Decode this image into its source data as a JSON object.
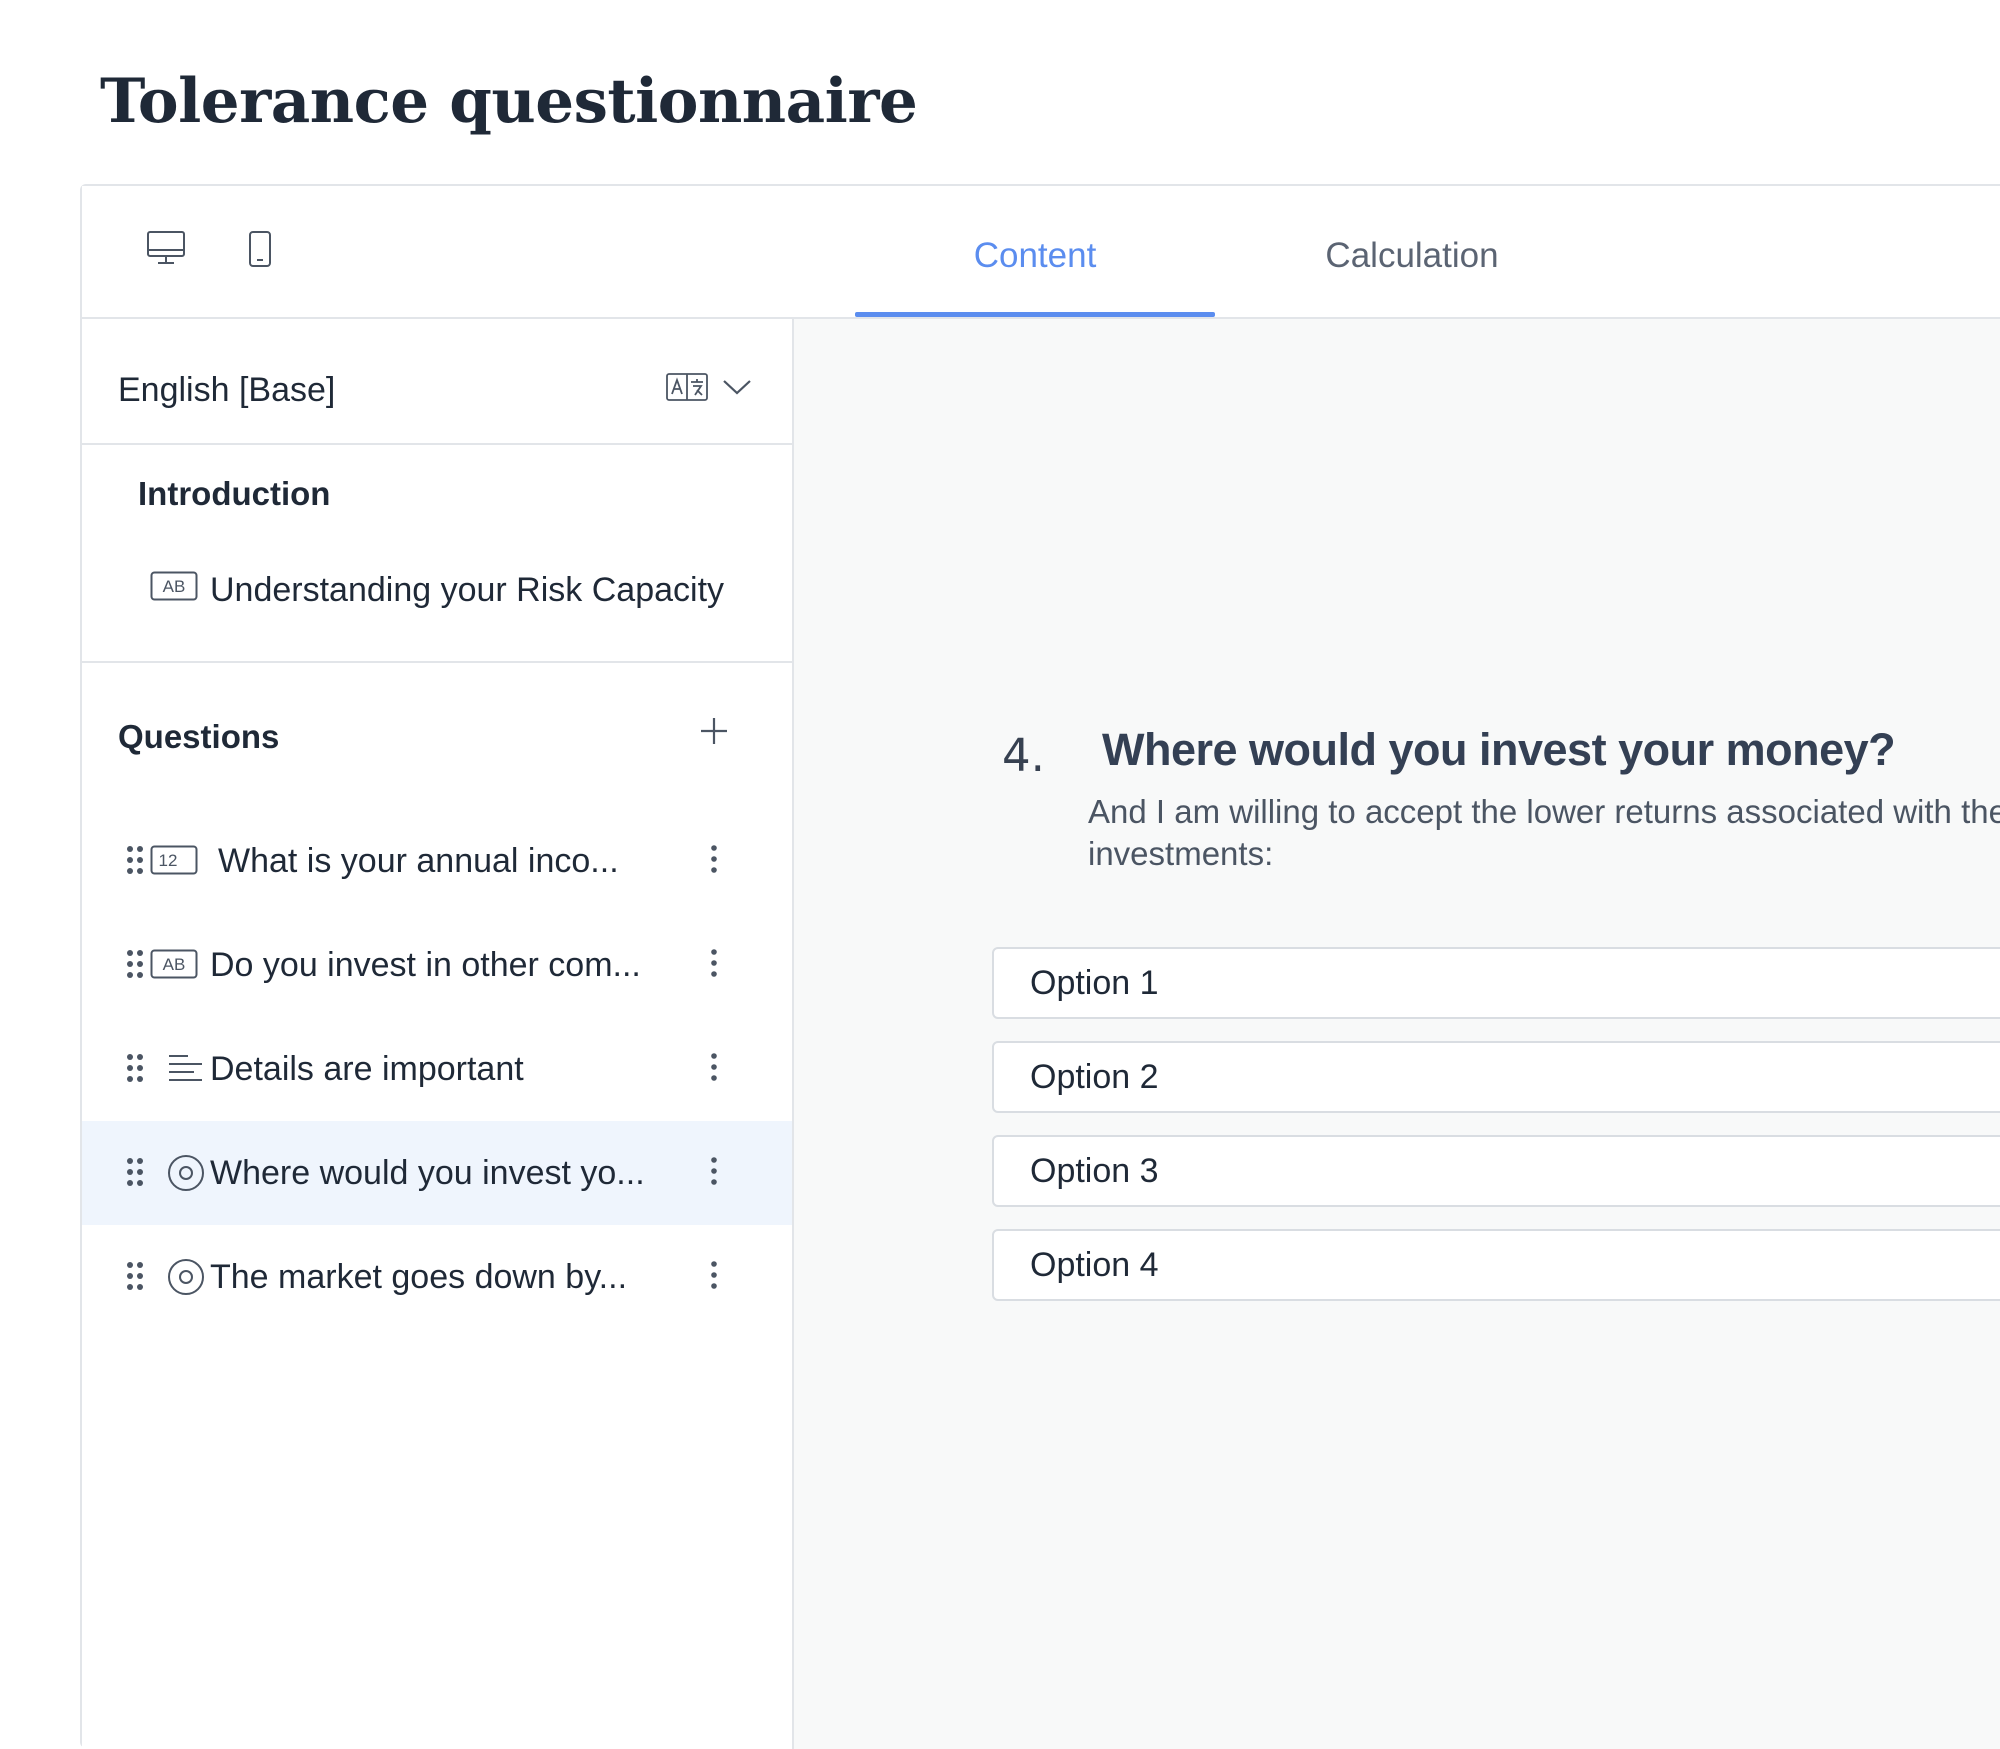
{
  "page": {
    "title": "Tolerance questionnaire"
  },
  "toolbar": {
    "device_desktop_icon": "desktop-icon",
    "device_mobile_icon": "mobile-icon",
    "tabs": [
      {
        "label": "Content",
        "active": true
      },
      {
        "label": "Calculation",
        "active": false
      }
    ],
    "accent_color": "#5b8def"
  },
  "sidebar": {
    "language": {
      "label": "English [Base]",
      "translate_icon": "translate-icon",
      "chevron_icon": "chevron-down-icon"
    },
    "introduction": {
      "heading": "Introduction",
      "item": {
        "icon": "text-ab-icon",
        "label": "Understanding your Risk Capacity"
      }
    },
    "questions": {
      "heading": "Questions",
      "add_icon": "plus-icon",
      "items": [
        {
          "icon": "number-icon",
          "icon_text": "12",
          "label": "What is your annual inco...",
          "selected": false
        },
        {
          "icon": "text-ab-icon",
          "icon_text": "AB",
          "label": "Do you invest in other com...",
          "selected": false
        },
        {
          "icon": "paragraph-icon",
          "label": "Details are important",
          "selected": false
        },
        {
          "icon": "radio-icon",
          "label": "Where would you invest yo...",
          "selected": true
        },
        {
          "icon": "radio-icon",
          "label": "The market goes down by...",
          "selected": false
        }
      ]
    }
  },
  "preview": {
    "number": "4.",
    "title": "Where would you invest your money?",
    "description": "And I am willing to accept the lower returns associated with these investments:",
    "options": [
      "Option 1",
      "Option 2",
      "Option 3",
      "Option 4"
    ]
  }
}
